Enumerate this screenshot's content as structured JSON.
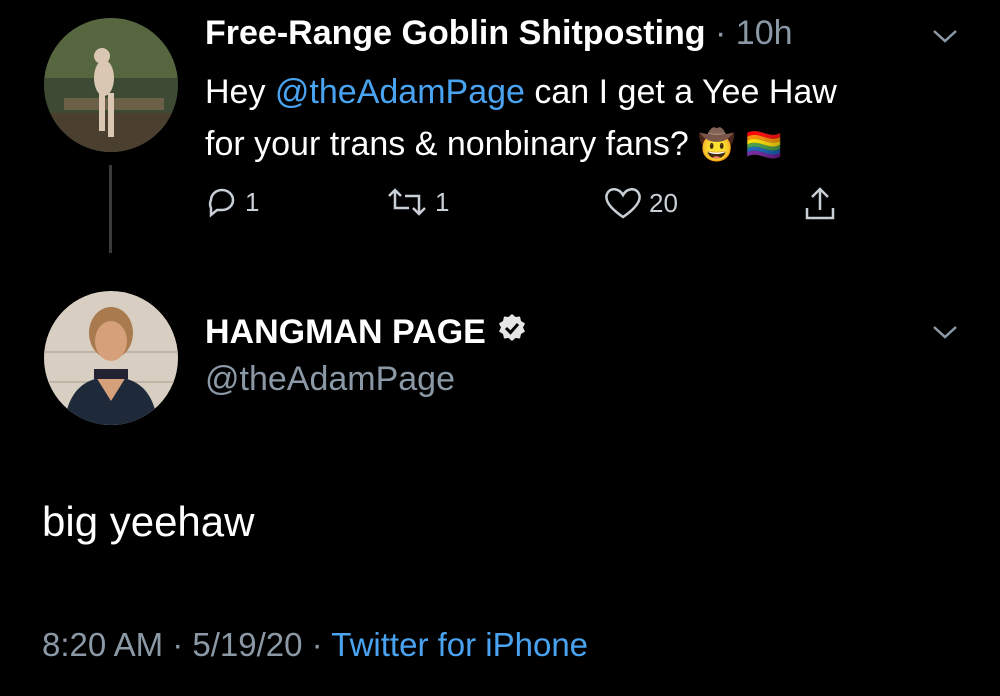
{
  "tweet_reply_to": {
    "author_name": "Free-Range Goblin Shitposting",
    "separator": "·",
    "time": "10h",
    "text_before": "Hey ",
    "mention": "@theAdamPage",
    "text_line1_after": " can I get a Yee Haw",
    "text_line2": "for your trans & nonbinary fans? ",
    "emoji_cowboy": "🤠",
    "emoji_flag": "🏳️‍🌈",
    "reply_count": "1",
    "retweet_count": "1",
    "like_count": "20"
  },
  "tweet_main": {
    "author_name": "HANGMAN PAGE",
    "handle": "@theAdamPage",
    "text": "big yeehaw",
    "time": "8:20 AM",
    "sep1": " · ",
    "date": "5/19/20",
    "sep2": " · ",
    "source": "Twitter for iPhone"
  },
  "icons": {
    "reply": "reply-icon",
    "retweet": "retweet-icon",
    "like": "heart-icon",
    "share": "share-icon",
    "more": "chevron-down-icon",
    "verified": "verified-badge-icon"
  },
  "colors": {
    "background": "#000000",
    "text": "#ffffff",
    "muted": "#8b98a5",
    "link": "#4aa3f0"
  }
}
